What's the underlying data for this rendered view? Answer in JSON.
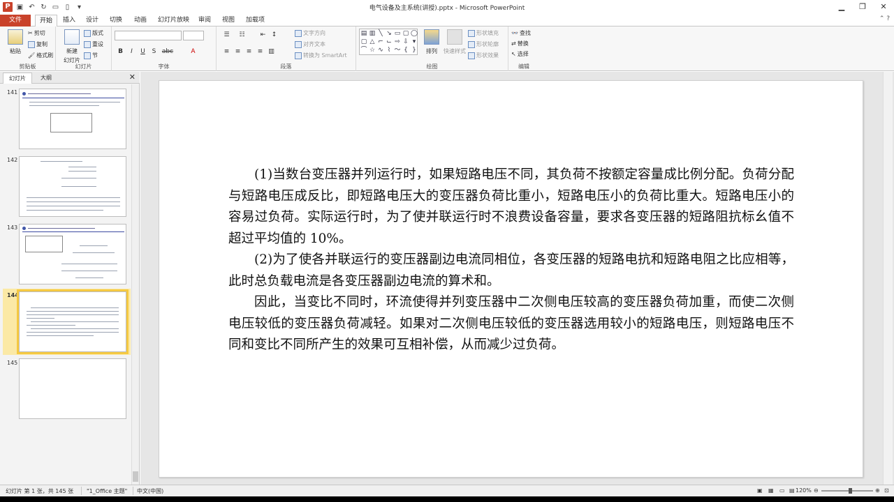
{
  "window": {
    "title": "电气设备及主系统(讲授).pptx - Microsoft PowerPoint",
    "controls": [
      "▁",
      "❐",
      "✕"
    ]
  },
  "ribbon_tabs": {
    "file": "文件",
    "tabs": [
      "开始",
      "插入",
      "设计",
      "切换",
      "动画",
      "幻灯片放映",
      "审阅",
      "视图",
      "加载项"
    ],
    "active": "开始"
  },
  "ribbon": {
    "clipboard": {
      "paste": "粘贴",
      "cut": "剪切",
      "copy": "复制",
      "format_painter": "格式刷",
      "label": "剪贴板"
    },
    "slides": {
      "new_slide": "新建",
      "new_slide2": "幻灯片",
      "layout": "版式",
      "reset": "重设",
      "section": "节",
      "label": "幻灯片"
    },
    "font": {
      "label": "字体",
      "font_name": "",
      "font_size": "",
      "bold": "B",
      "italic": "I",
      "underline": "U",
      "strike": "S",
      "shadow": "abc"
    },
    "paragraph": {
      "label": "段落",
      "text_direction": "文字方向",
      "align_text": "对齐文本",
      "smartart": "转换为 SmartArt"
    },
    "drawing": {
      "label": "绘图",
      "arrange": "排列",
      "quick_styles": "快速样式",
      "fill": "形状填充",
      "outline": "形状轮廓",
      "effects": "形状效果"
    },
    "editing": {
      "label": "编辑",
      "find": "查找",
      "replace": "替换",
      "select": "选择"
    }
  },
  "slide_panel": {
    "tabs": [
      "幻灯片",
      "大纲"
    ],
    "active_tab": "幻灯片",
    "thumbnails": [
      {
        "number": "141",
        "selected": false
      },
      {
        "number": "142",
        "selected": false
      },
      {
        "number": "143",
        "selected": false
      },
      {
        "number": "144",
        "selected": true
      },
      {
        "number": "145",
        "selected": false
      }
    ]
  },
  "slide": {
    "paragraphs": [
      "(1)当数台变压器并列运行时，如果短路电压不同，其负荷不按额定容量成比例分配。负荷分配与短路电压成反比，即短路电压大的变压器负荷比重小，短路电压小的负荷比重大。短路电压小的容易过负荷。实际运行时，为了使并联运行时不浪费设备容量，要求各变压器的短路阻抗标幺值不超过平均值的 10%。",
      "(2)为了使各并联运行的变压器副边电流同相位，各变压器的短路电抗和短路电阻之比应相等，此时总负载电流是各变压器副边电流的算术和。",
      "因此，当变比不同时，环流使得并列变压器中二次侧电压较高的变压器负荷加重，而使二次侧电压较低的变压器负荷减轻。如果对二次侧电压较低的变压器选用较小的短路电压，则短路电压不同和变比不同所产生的效果可互相补偿，从而减少过负荷。"
    ]
  },
  "statusbar": {
    "slide_info": "幻灯片 第 1 张，共 145 张",
    "theme": "\"1_Office 主题\"",
    "language": "中文(中国)",
    "zoom": "120%",
    "zoom_fraction": 0.55
  }
}
